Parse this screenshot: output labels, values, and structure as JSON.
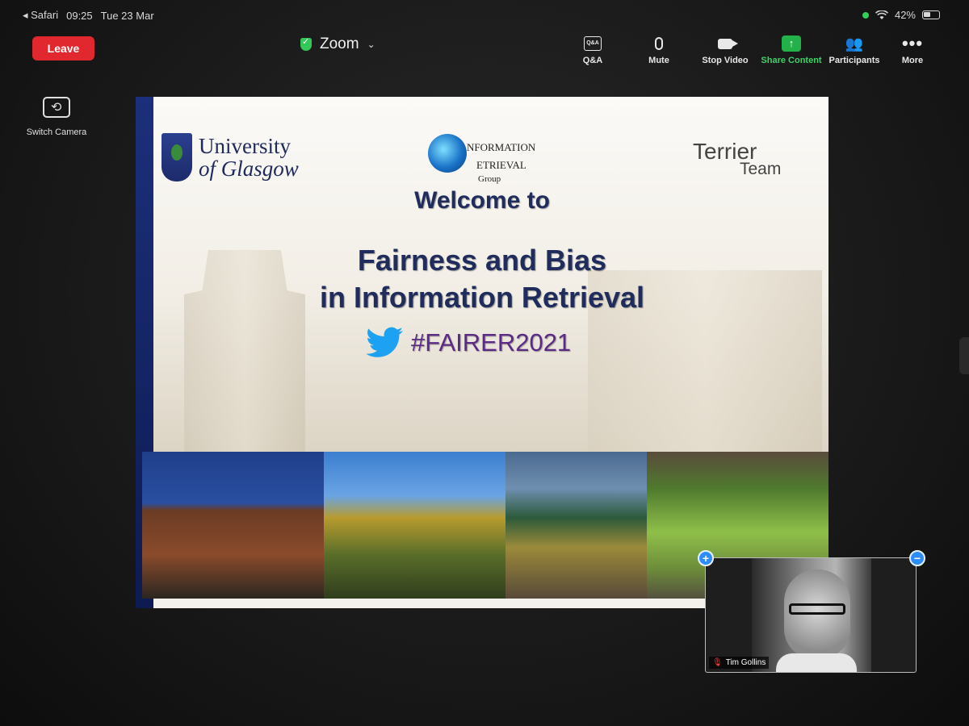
{
  "status_bar": {
    "back_app": "◂ Safari",
    "time": "09:25",
    "date": "Tue 23 Mar",
    "battery": "42%"
  },
  "meeting": {
    "leave_label": "Leave",
    "app_title": "Zoom"
  },
  "toolbar": {
    "qa_icon_text": "Q&A",
    "qa_label": "Q&A",
    "mute_label": "Mute",
    "stop_video_label": "Stop Video",
    "share_label": "Share Content",
    "participants_label": "Participants",
    "more_label": "More"
  },
  "switch_camera": {
    "label": "Switch Camera"
  },
  "slide": {
    "uog_line1": "University",
    "uog_line2": "of Glasgow",
    "irg_line1": "NFORMATION",
    "irg_line2": "ETRIEVAL",
    "irg_group": "Group",
    "terrier": "Terrier",
    "team": "Team",
    "welcome": "Welcome to",
    "title_line1": "Fairness and Bias",
    "title_line2": "in Information Retrieval",
    "hashtag": "#FAIRER2021"
  },
  "self_video": {
    "participant_name": "Tim Gollins",
    "plus": "+",
    "minus": "−"
  },
  "colors": {
    "leave": "#e0282e",
    "share_accent": "#23b24a",
    "slide_title": "#1f2c5c",
    "hashtag": "#5b2a86",
    "twitter_blue": "#1da1f2"
  },
  "icons": [
    "back-arrow-icon",
    "wifi-icon",
    "battery-icon",
    "shield-check-icon",
    "chevron-down-icon",
    "qa-icon",
    "microphone-icon",
    "video-camera-icon",
    "share-content-icon",
    "participants-icon",
    "more-dots-icon",
    "switch-camera-icon",
    "twitter-bird-icon",
    "muted-mic-icon"
  ]
}
